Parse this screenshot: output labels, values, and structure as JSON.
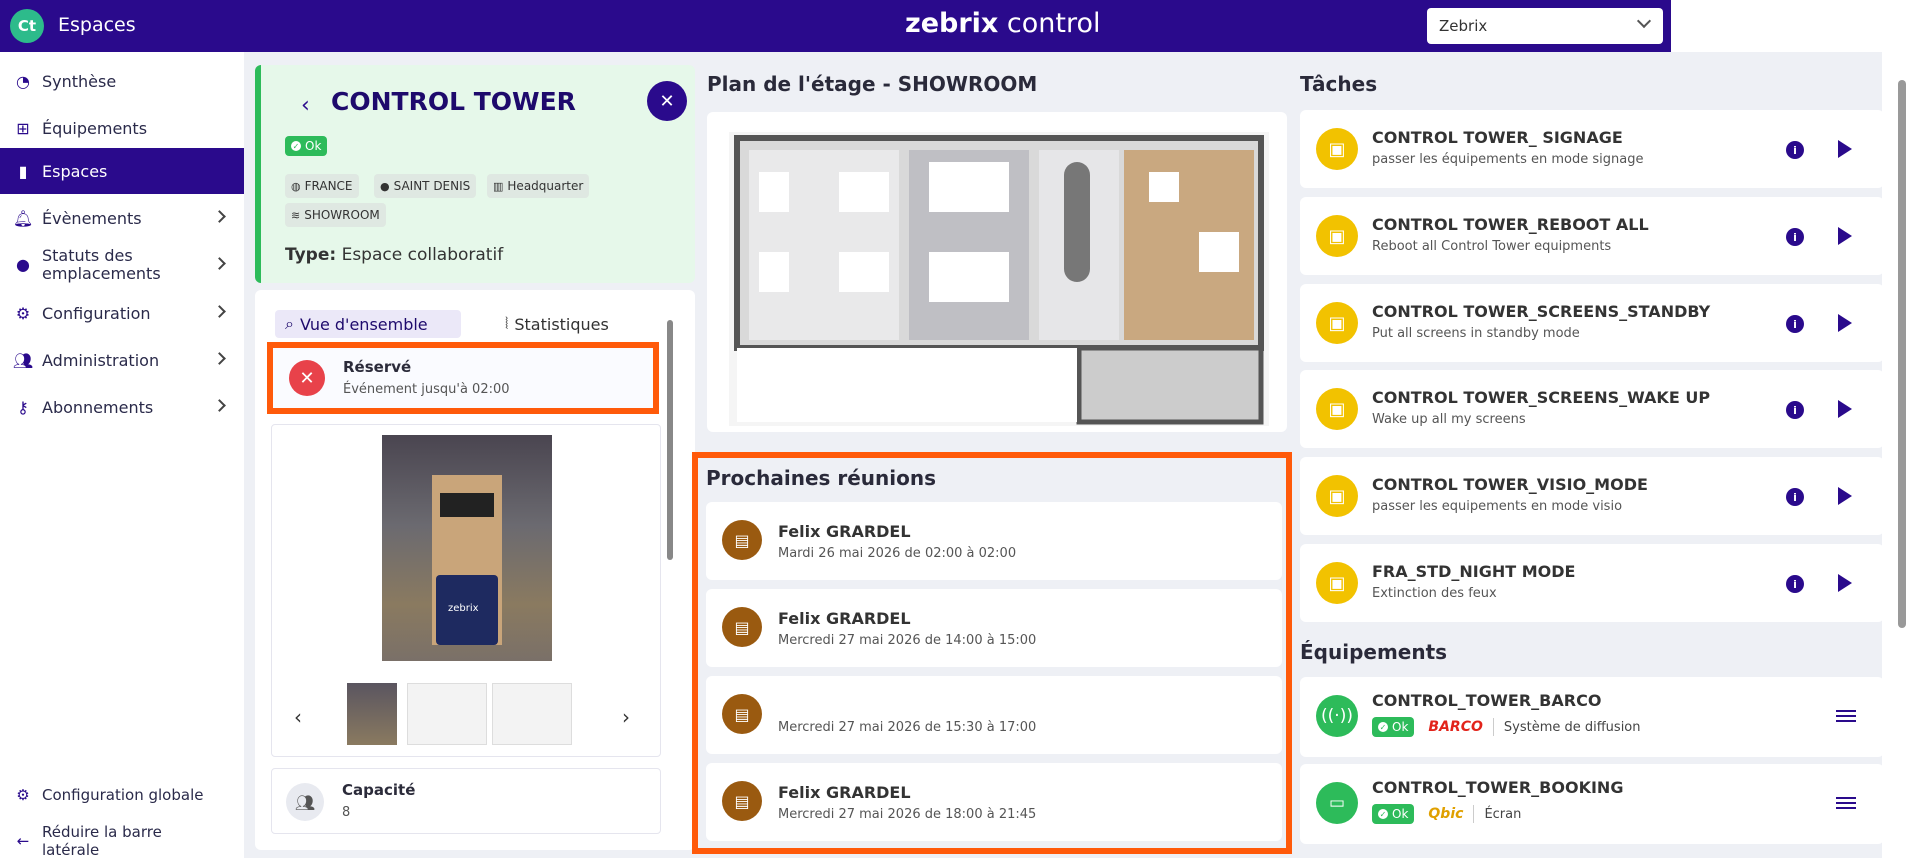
{
  "header": {
    "logo_text": "Ct",
    "app_title": "Espaces",
    "brand_bold": "zebrix",
    "brand_light": " control",
    "tenant_selected": "Zebrix"
  },
  "sidebar": {
    "items": [
      {
        "label": "Synthèse",
        "icon": "dashboard-icon"
      },
      {
        "label": "Équipements",
        "icon": "network-icon"
      },
      {
        "label": "Espaces",
        "icon": "door-icon"
      },
      {
        "label": "Évènements",
        "icon": "bell-icon"
      },
      {
        "label": "Statuts des emplacements",
        "icon": "pin-icon"
      },
      {
        "label": "Configuration",
        "icon": "gears-icon"
      },
      {
        "label": "Administration",
        "icon": "users-icon"
      },
      {
        "label": "Abonnements",
        "icon": "key-icon"
      }
    ],
    "global_config": "Configuration globale",
    "collapse_label": "Réduire la barre latérale"
  },
  "space": {
    "title": "CONTROL TOWER",
    "status": "Ok",
    "tags": [
      "FRANCE",
      "SAINT DENIS",
      "Headquarter",
      "SHOWROOM"
    ],
    "type_label": "Type:",
    "type_value": "Espace collaboratif"
  },
  "left_panel": {
    "tab_overview": "Vue d'ensemble",
    "tab_stats": "Statistiques",
    "reserved_title": "Réservé",
    "reserved_sub": "Événement jusqu'à 02:00",
    "photo_caption": "zebrix",
    "capacity_label": "Capacité",
    "capacity_value": "8"
  },
  "floor": {
    "title": "Plan de l'étage - SHOWROOM"
  },
  "meetings": {
    "title": "Prochaines réunions",
    "items": [
      {
        "name": "Felix GRARDEL",
        "when": "Mardi 26 mai 2026 de 02:00 à 02:00"
      },
      {
        "name": "Felix GRARDEL",
        "when": "Mercredi 27 mai 2026 de 14:00 à 15:00"
      },
      {
        "name": "",
        "when": "Mercredi 27 mai 2026 de 15:30 à 17:00"
      },
      {
        "name": "Felix GRARDEL",
        "when": "Mercredi 27 mai 2026 de 18:00 à 21:45"
      }
    ]
  },
  "tasks": {
    "title": "Tâches",
    "items": [
      {
        "name": "CONTROL TOWER_ SIGNAGE",
        "desc": "passer les équipements en mode signage"
      },
      {
        "name": "CONTROL TOWER_REBOOT ALL",
        "desc": "Reboot all Control Tower equipments"
      },
      {
        "name": "CONTROL TOWER_SCREENS_STANDBY",
        "desc": "Put all screens in standby mode"
      },
      {
        "name": "CONTROL TOWER_SCREENS_WAKE UP",
        "desc": "Wake up all my screens"
      },
      {
        "name": "CONTROL TOWER_VISIO_MODE",
        "desc": "passer les equipements en mode visio"
      },
      {
        "name": "FRA_STD_NIGHT MODE",
        "desc": "Extinction des feux"
      }
    ]
  },
  "equipments": {
    "title": "Équipements",
    "items": [
      {
        "name": "CONTROL_TOWER_BARCO",
        "status": "Ok",
        "brand": "BARCO",
        "brand_color": "#e2231a",
        "kind": "Système de diffusion"
      },
      {
        "name": "CONTROL_TOWER_BOOKING",
        "status": "Ok",
        "brand": "Qbic",
        "brand_color": "#e0a000",
        "kind": "Écran"
      }
    ]
  }
}
